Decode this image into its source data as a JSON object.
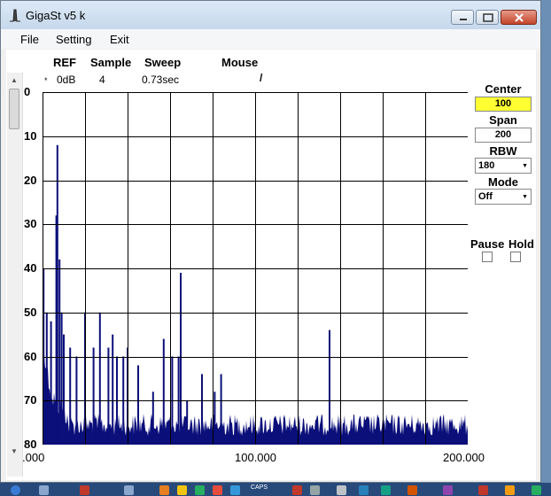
{
  "window": {
    "title": "GigaSt v5 k"
  },
  "menu": {
    "file": "File",
    "setting": "Setting",
    "exit": "Exit"
  },
  "header": {
    "ref_label": "REF",
    "sample_label": "Sample",
    "sweep_label": "Sweep",
    "mouse_label": "Mouse",
    "ref_marker": "*",
    "ref_value": "0dB",
    "sample_value": "4",
    "sweep_value": "0.73sec",
    "mouse_value": "/"
  },
  "controls": {
    "center_label": "Center",
    "center_value": "100",
    "span_label": "Span",
    "span_value": "200",
    "rbw_label": "RBW",
    "rbw_value": "180",
    "mode_label": "Mode",
    "mode_value": "Off",
    "pause_label": "Pause",
    "hold_label": "Hold"
  },
  "taskbar": {
    "caps": "CAPS"
  },
  "colors": {
    "trace": "#0b0f7a",
    "grid": "#000000",
    "center_field": "#ffff33"
  },
  "chart_data": {
    "type": "area",
    "y_ticks": [
      "0",
      "10",
      "20",
      "30",
      "40",
      "50",
      "60",
      "70",
      "80"
    ],
    "x_ticks": [
      ".000",
      "100.000",
      "200.000"
    ],
    "xlim": [
      0,
      200
    ],
    "ylim": [
      0,
      80
    ],
    "y_inverted": true,
    "grid": true,
    "noise_floor_db": 74,
    "peaks": [
      {
        "x": 0.5,
        "depth": 40
      },
      {
        "x": 2,
        "depth": 50
      },
      {
        "x": 4,
        "depth": 52
      },
      {
        "x": 6.5,
        "depth": 28
      },
      {
        "x": 7,
        "depth": 12
      },
      {
        "x": 8,
        "depth": 38
      },
      {
        "x": 9,
        "depth": 50
      },
      {
        "x": 10,
        "depth": 55
      },
      {
        "x": 13,
        "depth": 58
      },
      {
        "x": 16,
        "depth": 60
      },
      {
        "x": 20,
        "depth": 50
      },
      {
        "x": 24,
        "depth": 58
      },
      {
        "x": 27,
        "depth": 50
      },
      {
        "x": 31,
        "depth": 58
      },
      {
        "x": 33,
        "depth": 55
      },
      {
        "x": 35,
        "depth": 60
      },
      {
        "x": 38,
        "depth": 60
      },
      {
        "x": 40,
        "depth": 58
      },
      {
        "x": 45,
        "depth": 62
      },
      {
        "x": 52,
        "depth": 68
      },
      {
        "x": 57,
        "depth": 56
      },
      {
        "x": 61,
        "depth": 60
      },
      {
        "x": 64,
        "depth": 60
      },
      {
        "x": 65,
        "depth": 41
      },
      {
        "x": 68,
        "depth": 70
      },
      {
        "x": 75,
        "depth": 64
      },
      {
        "x": 81,
        "depth": 68
      },
      {
        "x": 84,
        "depth": 64
      },
      {
        "x": 135,
        "depth": 54
      }
    ]
  }
}
